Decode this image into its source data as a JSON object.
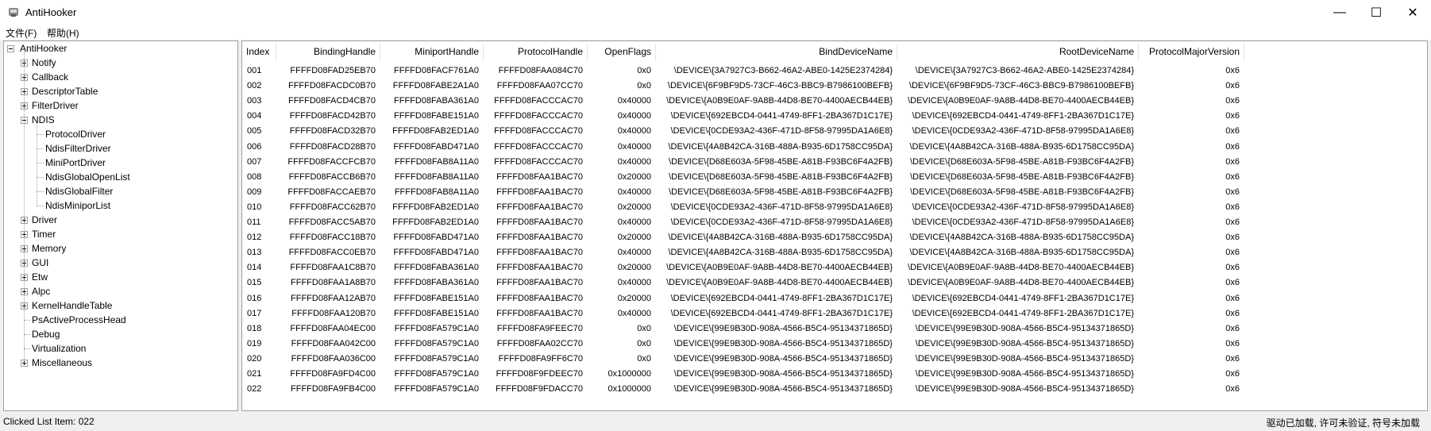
{
  "window": {
    "title": "AntiHooker",
    "minimize_glyph": "—",
    "maximize_glyph": "☐",
    "close_glyph": "✕"
  },
  "menu": [
    {
      "label": "文件(F)"
    },
    {
      "label": "帮助(H)"
    }
  ],
  "tree": [
    {
      "label": "AntiHooker",
      "expander": "minus"
    },
    {
      "label": "Notify",
      "expander": "plus"
    },
    {
      "label": "Callback",
      "expander": "plus"
    },
    {
      "label": "DescriptorTable",
      "expander": "plus"
    },
    {
      "label": "FilterDriver",
      "expander": "plus"
    },
    {
      "label": "NDIS",
      "expander": "minus"
    },
    {
      "label": "ProtocolDriver",
      "expander": "none"
    },
    {
      "label": "NdisFilterDriver",
      "expander": "none"
    },
    {
      "label": "MiniPortDriver",
      "expander": "none"
    },
    {
      "label": "NdisGlobalOpenList",
      "expander": "none"
    },
    {
      "label": "NdisGlobalFilter",
      "expander": "none"
    },
    {
      "label": "NdisMiniporList",
      "expander": "none"
    },
    {
      "label": "Driver",
      "expander": "plus"
    },
    {
      "label": "Timer",
      "expander": "plus"
    },
    {
      "label": "Memory",
      "expander": "plus"
    },
    {
      "label": "GUI",
      "expander": "plus"
    },
    {
      "label": "Etw",
      "expander": "plus"
    },
    {
      "label": "Alpc",
      "expander": "plus"
    },
    {
      "label": "KernelHandleTable",
      "expander": "plus"
    },
    {
      "label": "PsActiveProcessHead",
      "expander": "none"
    },
    {
      "label": "Debug",
      "expander": "none"
    },
    {
      "label": "Virtualization",
      "expander": "none"
    },
    {
      "label": "Miscellaneous",
      "expander": "plus"
    }
  ],
  "columns": [
    "Index",
    "BindingHandle",
    "MiniportHandle",
    "ProtocolHandle",
    "OpenFlags",
    "BindDeviceName",
    "RootDeviceName",
    "ProtocolMajorVersion"
  ],
  "rows": [
    [
      "001",
      "FFFFD08FAD25EB70",
      "FFFFD08FACF761A0",
      "FFFFD08FAA084C70",
      "0x0",
      "\\DEVICE\\{3A7927C3-B662-46A2-ABE0-1425E2374284}",
      "\\DEVICE\\{3A7927C3-B662-46A2-ABE0-1425E2374284}",
      "0x6"
    ],
    [
      "002",
      "FFFFD08FACDC0B70",
      "FFFFD08FABE2A1A0",
      "FFFFD08FAA07CC70",
      "0x0",
      "\\DEVICE\\{6F9BF9D5-73CF-46C3-BBC9-B7986100BEFB}",
      "\\DEVICE\\{6F9BF9D5-73CF-46C3-BBC9-B7986100BEFB}",
      "0x6"
    ],
    [
      "003",
      "FFFFD08FACD4CB70",
      "FFFFD08FABA361A0",
      "FFFFD08FACCCAC70",
      "0x40000",
      "\\DEVICE\\{A0B9E0AF-9A8B-44D8-BE70-4400AECB44EB}",
      "\\DEVICE\\{A0B9E0AF-9A8B-44D8-BE70-4400AECB44EB}",
      "0x6"
    ],
    [
      "004",
      "FFFFD08FACD42B70",
      "FFFFD08FABE151A0",
      "FFFFD08FACCCAC70",
      "0x40000",
      "\\DEVICE\\{692EBCD4-0441-4749-8FF1-2BA367D1C17E}",
      "\\DEVICE\\{692EBCD4-0441-4749-8FF1-2BA367D1C17E}",
      "0x6"
    ],
    [
      "005",
      "FFFFD08FACD32B70",
      "FFFFD08FAB2ED1A0",
      "FFFFD08FACCCAC70",
      "0x40000",
      "\\DEVICE\\{0CDE93A2-436F-471D-8F58-97995DA1A6E8}",
      "\\DEVICE\\{0CDE93A2-436F-471D-8F58-97995DA1A6E8}",
      "0x6"
    ],
    [
      "006",
      "FFFFD08FACD28B70",
      "FFFFD08FABD471A0",
      "FFFFD08FACCCAC70",
      "0x40000",
      "\\DEVICE\\{4A8B42CA-316B-488A-B935-6D1758CC95DA}",
      "\\DEVICE\\{4A8B42CA-316B-488A-B935-6D1758CC95DA}",
      "0x6"
    ],
    [
      "007",
      "FFFFD08FACCFCB70",
      "FFFFD08FAB8A11A0",
      "FFFFD08FACCCAC70",
      "0x40000",
      "\\DEVICE\\{D68E603A-5F98-45BE-A81B-F93BC6F4A2FB}",
      "\\DEVICE\\{D68E603A-5F98-45BE-A81B-F93BC6F4A2FB}",
      "0x6"
    ],
    [
      "008",
      "FFFFD08FACCB6B70",
      "FFFFD08FAB8A11A0",
      "FFFFD08FAA1BAC70",
      "0x20000",
      "\\DEVICE\\{D68E603A-5F98-45BE-A81B-F93BC6F4A2FB}",
      "\\DEVICE\\{D68E603A-5F98-45BE-A81B-F93BC6F4A2FB}",
      "0x6"
    ],
    [
      "009",
      "FFFFD08FACCAEB70",
      "FFFFD08FAB8A11A0",
      "FFFFD08FAA1BAC70",
      "0x40000",
      "\\DEVICE\\{D68E603A-5F98-45BE-A81B-F93BC6F4A2FB}",
      "\\DEVICE\\{D68E603A-5F98-45BE-A81B-F93BC6F4A2FB}",
      "0x6"
    ],
    [
      "010",
      "FFFFD08FACC62B70",
      "FFFFD08FAB2ED1A0",
      "FFFFD08FAA1BAC70",
      "0x20000",
      "\\DEVICE\\{0CDE93A2-436F-471D-8F58-97995DA1A6E8}",
      "\\DEVICE\\{0CDE93A2-436F-471D-8F58-97995DA1A6E8}",
      "0x6"
    ],
    [
      "011",
      "FFFFD08FACC5AB70",
      "FFFFD08FAB2ED1A0",
      "FFFFD08FAA1BAC70",
      "0x40000",
      "\\DEVICE\\{0CDE93A2-436F-471D-8F58-97995DA1A6E8}",
      "\\DEVICE\\{0CDE93A2-436F-471D-8F58-97995DA1A6E8}",
      "0x6"
    ],
    [
      "012",
      "FFFFD08FACC18B70",
      "FFFFD08FABD471A0",
      "FFFFD08FAA1BAC70",
      "0x20000",
      "\\DEVICE\\{4A8B42CA-316B-488A-B935-6D1758CC95DA}",
      "\\DEVICE\\{4A8B42CA-316B-488A-B935-6D1758CC95DA}",
      "0x6"
    ],
    [
      "013",
      "FFFFD08FACC0EB70",
      "FFFFD08FABD471A0",
      "FFFFD08FAA1BAC70",
      "0x40000",
      "\\DEVICE\\{4A8B42CA-316B-488A-B935-6D1758CC95DA}",
      "\\DEVICE\\{4A8B42CA-316B-488A-B935-6D1758CC95DA}",
      "0x6"
    ],
    [
      "014",
      "FFFFD08FAA1C8B70",
      "FFFFD08FABA361A0",
      "FFFFD08FAA1BAC70",
      "0x20000",
      "\\DEVICE\\{A0B9E0AF-9A8B-44D8-BE70-4400AECB44EB}",
      "\\DEVICE\\{A0B9E0AF-9A8B-44D8-BE70-4400AECB44EB}",
      "0x6"
    ],
    [
      "015",
      "FFFFD08FAA1A8B70",
      "FFFFD08FABA361A0",
      "FFFFD08FAA1BAC70",
      "0x40000",
      "\\DEVICE\\{A0B9E0AF-9A8B-44D8-BE70-4400AECB44EB}",
      "\\DEVICE\\{A0B9E0AF-9A8B-44D8-BE70-4400AECB44EB}",
      "0x6"
    ],
    [
      "016",
      "FFFFD08FAA12AB70",
      "FFFFD08FABE151A0",
      "FFFFD08FAA1BAC70",
      "0x20000",
      "\\DEVICE\\{692EBCD4-0441-4749-8FF1-2BA367D1C17E}",
      "\\DEVICE\\{692EBCD4-0441-4749-8FF1-2BA367D1C17E}",
      "0x6"
    ],
    [
      "017",
      "FFFFD08FAA120B70",
      "FFFFD08FABE151A0",
      "FFFFD08FAA1BAC70",
      "0x40000",
      "\\DEVICE\\{692EBCD4-0441-4749-8FF1-2BA367D1C17E}",
      "\\DEVICE\\{692EBCD4-0441-4749-8FF1-2BA367D1C17E}",
      "0x6"
    ],
    [
      "018",
      "FFFFD08FAA04EC00",
      "FFFFD08FA579C1A0",
      "FFFFD08FA9FEEC70",
      "0x0",
      "\\DEVICE\\{99E9B30D-908A-4566-B5C4-95134371865D}",
      "\\DEVICE\\{99E9B30D-908A-4566-B5C4-95134371865D}",
      "0x6"
    ],
    [
      "019",
      "FFFFD08FAA042C00",
      "FFFFD08FA579C1A0",
      "FFFFD08FAA02CC70",
      "0x0",
      "\\DEVICE\\{99E9B30D-908A-4566-B5C4-95134371865D}",
      "\\DEVICE\\{99E9B30D-908A-4566-B5C4-95134371865D}",
      "0x6"
    ],
    [
      "020",
      "FFFFD08FAA036C00",
      "FFFFD08FA579C1A0",
      "FFFFD08FA9FF6C70",
      "0x0",
      "\\DEVICE\\{99E9B30D-908A-4566-B5C4-95134371865D}",
      "\\DEVICE\\{99E9B30D-908A-4566-B5C4-95134371865D}",
      "0x6"
    ],
    [
      "021",
      "FFFFD08FA9FD4C00",
      "FFFFD08FA579C1A0",
      "FFFFD08F9FDEEC70",
      "0x1000000",
      "\\DEVICE\\{99E9B30D-908A-4566-B5C4-95134371865D}",
      "\\DEVICE\\{99E9B30D-908A-4566-B5C4-95134371865D}",
      "0x6"
    ],
    [
      "022",
      "FFFFD08FA9FB4C00",
      "FFFFD08FA579C1A0",
      "FFFFD08F9FDACC70",
      "0x1000000",
      "\\DEVICE\\{99E9B30D-908A-4566-B5C4-95134371865D}",
      "\\DEVICE\\{99E9B30D-908A-4566-B5C4-95134371865D}",
      "0x6"
    ]
  ],
  "status": {
    "left": "Clicked List Item: 022",
    "right": "驱动已加载, 许可未验证, 符号未加载"
  }
}
